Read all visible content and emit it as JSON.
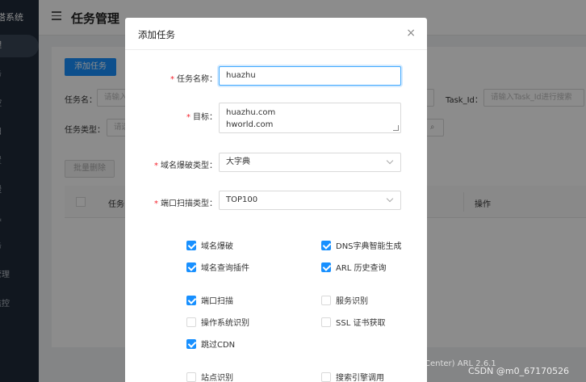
{
  "sidebar": {
    "title": "塔系统",
    "items": [
      "理",
      "务",
      "控",
      "扫",
      "置",
      "缓",
      "具",
      "务",
      "管理",
      "监控"
    ]
  },
  "header": {
    "title": "任务管理"
  },
  "toolbar": {
    "add_label": "添加任务",
    "batch_delete_label": "批量删除"
  },
  "filters": {
    "task_name_label": "任务名：",
    "task_name_placeholder": "请输入",
    "task_id_label": "Task_Id：",
    "task_id_placeholder": "请输入Task_Id进行搜索",
    "task_type_label": "任务类型：",
    "task_type_placeholder": "请选"
  },
  "table": {
    "col_name": "任务",
    "col_ops": "操作"
  },
  "footer": {
    "text": "Center) ARL 2.6.1"
  },
  "watermark": "CSDN @m0_67170526",
  "modal": {
    "title": "添加任务",
    "close_icon": "×",
    "fields": {
      "name_label": "任务名称：",
      "name_value": "huazhu",
      "target_label": "目标：",
      "target_value": [
        "huazhu.com",
        "hworld.com"
      ],
      "domain_brute_type_label": "域名爆破类型：",
      "domain_brute_type_value": "大字典",
      "port_scan_type_label": "端口扫描类型：",
      "port_scan_type_value": "TOP100"
    },
    "options": [
      {
        "label": "域名爆破",
        "checked": true
      },
      {
        "label": "DNS字典智能生成",
        "checked": true
      },
      {
        "label": "域名查询插件",
        "checked": true
      },
      {
        "label": "ARL 历史查询",
        "checked": true
      },
      {
        "label": "端口扫描",
        "checked": true
      },
      {
        "label": "服务识别",
        "checked": false
      },
      {
        "label": "操作系统识别",
        "checked": false
      },
      {
        "label": "SSL 证书获取",
        "checked": false
      },
      {
        "label": "跳过CDN",
        "checked": true
      },
      {
        "label": "站点识别",
        "checked": false
      },
      {
        "label": "搜索引擎调用",
        "checked": false
      }
    ]
  },
  "colors": {
    "primary": "#1890ff",
    "sidebar_bg": "#1f2b3a",
    "required": "#f5222d"
  }
}
